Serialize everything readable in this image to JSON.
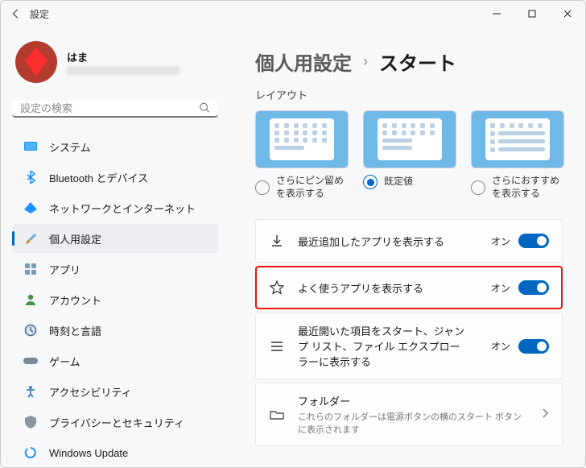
{
  "window": {
    "title": "設定"
  },
  "profile": {
    "name": "はま"
  },
  "search": {
    "placeholder": "設定の検索"
  },
  "nav": {
    "items": [
      {
        "label": "システム"
      },
      {
        "label": "Bluetooth とデバイス"
      },
      {
        "label": "ネットワークとインターネット"
      },
      {
        "label": "個人用設定"
      },
      {
        "label": "アプリ"
      },
      {
        "label": "アカウント"
      },
      {
        "label": "時刻と言語"
      },
      {
        "label": "ゲーム"
      },
      {
        "label": "アクセシビリティ"
      },
      {
        "label": "プライバシーとセキュリティ"
      },
      {
        "label": "Windows Update"
      }
    ]
  },
  "breadcrumb": {
    "parent": "個人用設定",
    "current": "スタート"
  },
  "section": {
    "layout": "レイアウト"
  },
  "layout_options": [
    {
      "label": "さらにピン留めを表示する"
    },
    {
      "label": "既定値"
    },
    {
      "label": "さらにおすすめを表示する"
    }
  ],
  "settings": [
    {
      "title": "最近追加したアプリを表示する",
      "state": "オン"
    },
    {
      "title": "よく使うアプリを表示する",
      "state": "オン"
    },
    {
      "title": "最近開いた項目をスタート、ジャンプ リスト、ファイル エクスプローラーに表示する",
      "state": "オン"
    },
    {
      "title": "フォルダー",
      "sub": "これらのフォルダーは電源ボタンの横のスタート ボタンに表示されます"
    }
  ]
}
